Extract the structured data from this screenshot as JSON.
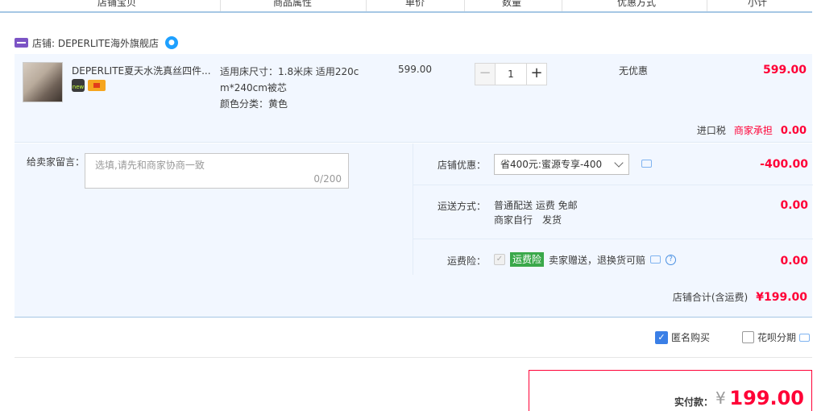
{
  "header": {
    "columns": [
      "店铺宝贝",
      "商品属性",
      "单价",
      "数量",
      "优惠方式",
      "小计"
    ]
  },
  "shop": {
    "label": "店铺: DEPERLITE海外旗舰店",
    "icon": "shop-icon",
    "chat_icon": "wangwang-icon"
  },
  "item": {
    "title": "DEPERLITE夏天水洗真丝四件...",
    "attr_line1": "适用床尺寸：1.8米床 适用220c",
    "attr_line2": "m*240cm被芯",
    "attr_line3": "颜色分类：黄色",
    "unit_price": "599.00",
    "quantity": "1",
    "qty_minus": "−",
    "qty_plus": "+",
    "promotion": "无优惠",
    "subtotal": "599.00",
    "tax_label": "进口税",
    "tax_payer": "商家承担",
    "tax_value": "0.00",
    "badge_new": "new"
  },
  "order": {
    "message_label": "给卖家留言：",
    "message_placeholder": "选填,请先和商家协商一致",
    "message_count": "0/200",
    "discount_label": "店铺优惠：",
    "discount_option": "省400元:蜜源专享-400",
    "discount_value": "-400.00",
    "shipping_label": "运送方式：",
    "shipping_line1": "普通配送 运费 免邮",
    "shipping_line2": "商家自行　发货",
    "shipping_value": "0.00",
    "insurance_label": "运费险：",
    "insurance_tag": "运费险",
    "insurance_text": "卖家赠送，退换货可赔",
    "insurance_value": "0.00",
    "shop_total_label": "店铺合计(含运费)",
    "shop_total_value": "¥199.00"
  },
  "options": {
    "anonymous_label": "匿名购买",
    "anonymous_checked": true,
    "huabei_label": "花呗分期",
    "huabei_checked": false
  },
  "payment": {
    "label": "实付款：",
    "currency": "¥",
    "value": "199.00"
  },
  "colors": {
    "accent_red": "#ff0036",
    "row_bg": "#f2f7ff",
    "header_line": "#a6c7e4",
    "checkbox_blue": "#3a7fe6"
  }
}
